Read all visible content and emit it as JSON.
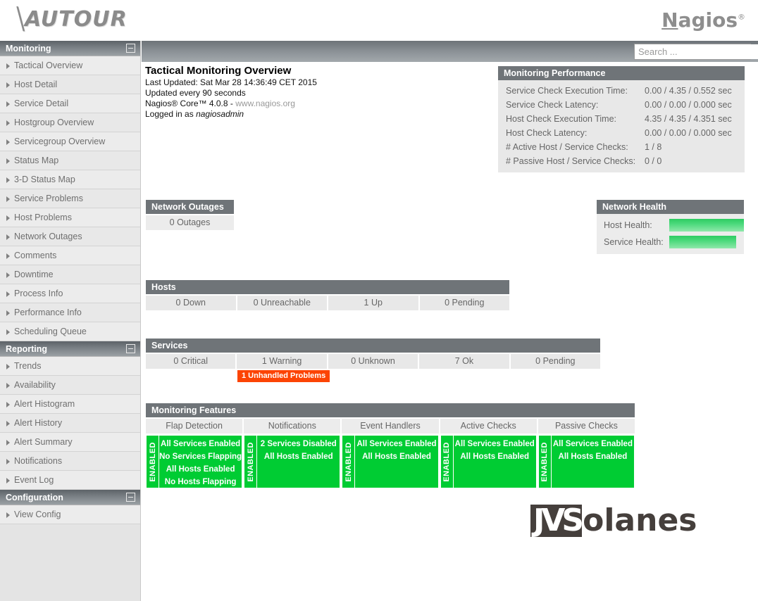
{
  "banner": {
    "left_logo": "AUTOUR",
    "right_logo_name": "Nagios",
    "right_logo_first_letter": "N",
    "right_logo_rest": "agios",
    "right_logo_mark": "®"
  },
  "search": {
    "placeholder": "Search ...",
    "value": "",
    "icon": "search-icon"
  },
  "sidebar": {
    "sections": [
      {
        "title": "Monitoring",
        "collapse_icon": "collapse-minus-icon",
        "items": [
          {
            "label": "Tactical Overview"
          },
          {
            "label": "Host Detail"
          },
          {
            "label": "Service Detail"
          },
          {
            "label": "Hostgroup Overview"
          },
          {
            "label": "Servicegroup Overview"
          },
          {
            "label": "Status Map"
          },
          {
            "label": "3-D Status Map"
          },
          {
            "label": "Service Problems"
          },
          {
            "label": "Host Problems"
          },
          {
            "label": "Network Outages"
          },
          {
            "label": "Comments"
          },
          {
            "label": "Downtime"
          },
          {
            "label": "Process Info"
          },
          {
            "label": "Performance Info"
          },
          {
            "label": "Scheduling Queue"
          }
        ]
      },
      {
        "title": "Reporting",
        "collapse_icon": "collapse-minus-icon",
        "items": [
          {
            "label": "Trends"
          },
          {
            "label": "Availability"
          },
          {
            "label": "Alert Histogram"
          },
          {
            "label": "Alert History"
          },
          {
            "label": "Alert Summary"
          },
          {
            "label": "Notifications"
          },
          {
            "label": "Event Log"
          }
        ]
      },
      {
        "title": "Configuration",
        "collapse_icon": "collapse-minus-icon",
        "items": [
          {
            "label": "View Config"
          }
        ]
      }
    ]
  },
  "page": {
    "title": "Tactical Monitoring Overview",
    "last_updated": "Last Updated: Sat Mar 28 14:36:49 CET 2015",
    "update_interval": "Updated every 90 seconds",
    "version_prefix": "Nagios® Core™ 4.0.8 - ",
    "version_link": "www.nagios.org",
    "logged_in_prefix": "Logged in as ",
    "logged_in_user": "nagiosadmin"
  },
  "performance": {
    "title": "Monitoring Performance",
    "rows": [
      {
        "label": "Service Check Execution Time:",
        "value": "0.00 / 4.35 / 0.552 sec"
      },
      {
        "label": "Service Check Latency:",
        "value": "0.00 / 0.00 / 0.000 sec"
      },
      {
        "label": "Host Check Execution Time:",
        "value": "4.35 / 4.35 / 4.351 sec"
      },
      {
        "label": "Host Check Latency:",
        "value": "0.00 / 0.00 / 0.000 sec"
      },
      {
        "label": "# Active Host / Service Checks:",
        "value": "1 / 8"
      },
      {
        "label": "# Passive Host / Service Checks:",
        "value": "0 / 0"
      }
    ]
  },
  "outages": {
    "title": "Network Outages",
    "count_label": "0 Outages"
  },
  "health": {
    "title": "Network Health",
    "rows": [
      {
        "label": "Host Health:",
        "percent": 100,
        "color": "#2ecc62"
      },
      {
        "label": "Service Health:",
        "percent": 90,
        "color": "#2ecc62"
      }
    ]
  },
  "hosts": {
    "title": "Hosts",
    "cells": [
      {
        "label": "0 Down"
      },
      {
        "label": "0 Unreachable"
      },
      {
        "label": "1 Up"
      },
      {
        "label": "0 Pending"
      }
    ]
  },
  "services": {
    "title": "Services",
    "cells": [
      {
        "label": "0 Critical"
      },
      {
        "label": "1 Warning"
      },
      {
        "label": "0 Unknown"
      },
      {
        "label": "7 Ok"
      },
      {
        "label": "0 Pending"
      }
    ],
    "unhandled_badge": "1 Unhandled Problems",
    "unhandled_color": "#fc4404"
  },
  "features": {
    "title": "Monitoring Features",
    "enabled_label": "ENABLED",
    "enabled_color": "#00cc33",
    "alert_color": "#fc2200",
    "columns": [
      {
        "header": "Flap Detection",
        "state": "ENABLED",
        "items": [
          {
            "text": "All Services Enabled",
            "alert": false
          },
          {
            "text": "No Services Flapping",
            "alert": false
          },
          {
            "text": "All Hosts Enabled",
            "alert": false
          },
          {
            "text": "No Hosts Flapping",
            "alert": false
          }
        ]
      },
      {
        "header": "Notifications",
        "state": "ENABLED",
        "items": [
          {
            "text": "2 Services Disabled",
            "alert": true
          },
          {
            "text": "All Hosts Enabled",
            "alert": false
          }
        ]
      },
      {
        "header": "Event Handlers",
        "state": "ENABLED",
        "items": [
          {
            "text": "All Services Enabled",
            "alert": false
          },
          {
            "text": "All Hosts Enabled",
            "alert": false
          }
        ]
      },
      {
        "header": "Active Checks",
        "state": "ENABLED",
        "items": [
          {
            "text": "All Services Enabled",
            "alert": false
          },
          {
            "text": "All Hosts Enabled",
            "alert": false
          }
        ]
      },
      {
        "header": "Passive Checks",
        "state": "ENABLED",
        "items": [
          {
            "text": "All Services Enabled",
            "alert": false
          },
          {
            "text": "All Hosts Enabled",
            "alert": false
          }
        ]
      }
    ]
  },
  "footer_logo": {
    "monogram": "JVS",
    "rest": "olanes"
  }
}
